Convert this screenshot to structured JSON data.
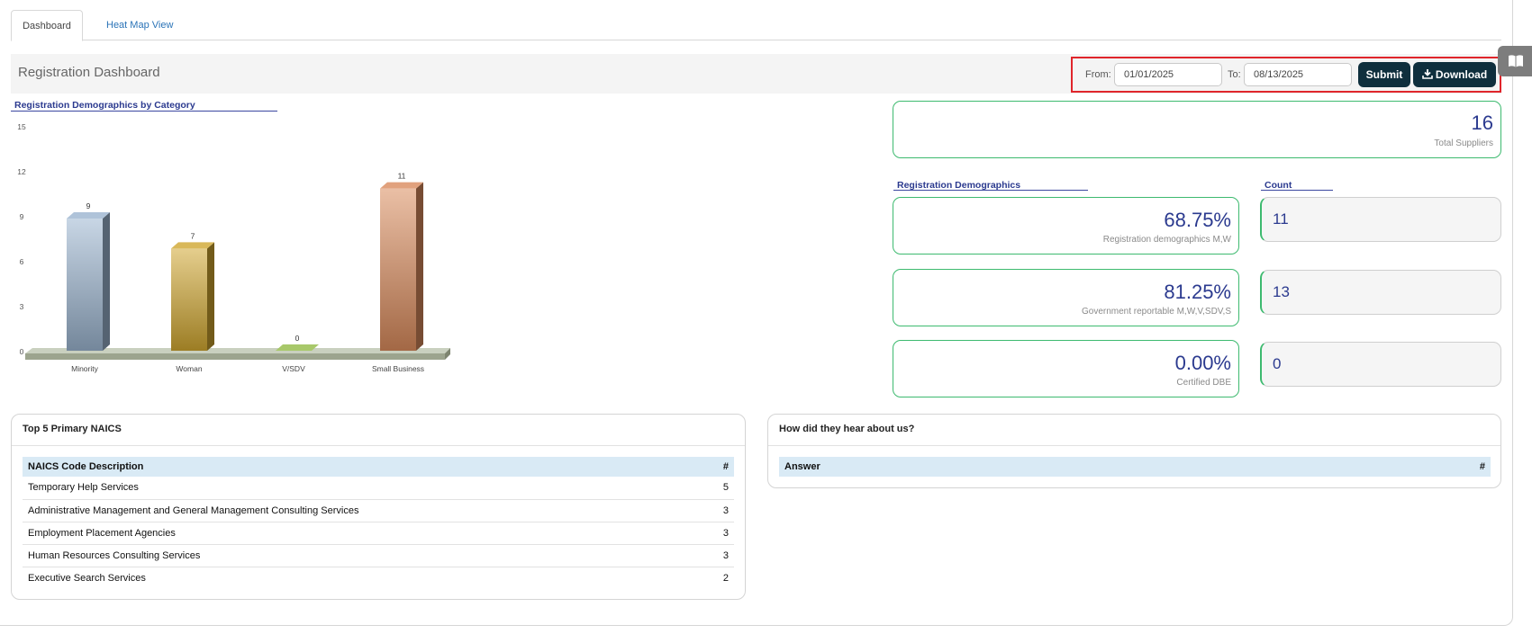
{
  "tabs": [
    {
      "label": "Dashboard",
      "active": true
    },
    {
      "label": "Heat Map View",
      "active": false
    }
  ],
  "header": {
    "title": "Registration Dashboard",
    "from_label": "From:",
    "from_value": "01/01/2025",
    "to_label": "To:",
    "to_value": "08/13/2025",
    "submit_label": "Submit",
    "download_label": "Download"
  },
  "icons": {
    "download": "download-icon",
    "side": "book-icon"
  },
  "colors": {
    "accent_dark": "#0f2f3d",
    "card_border": "#3dba6f",
    "value_text": "#2b3a8f",
    "highlight": "#e0252b",
    "table_header": "#d9eaf5"
  },
  "chart_data": {
    "type": "bar",
    "title": "Registration Demographics by Category",
    "categories": [
      "Minority",
      "Woman",
      "V/SDV",
      "Small Business"
    ],
    "values": [
      9,
      7,
      0,
      11
    ],
    "yticks": [
      0,
      3,
      6,
      9,
      12,
      15
    ],
    "ylim": [
      0,
      15
    ],
    "bar_colors": [
      "#9bb4cf",
      "#d0a630",
      "#a8c86a",
      "#d98a5c"
    ],
    "grid": false,
    "legend": "none",
    "style": "3d"
  },
  "summary": {
    "total_value": "16",
    "total_label": "Total Suppliers"
  },
  "demographics": {
    "heading": "Registration Demographics",
    "count_heading": "Count",
    "items": [
      {
        "value": "68.75%",
        "label": "Registration demographics M,W",
        "count": "11"
      },
      {
        "value": "81.25%",
        "label": "Government reportable M,W,V,SDV,S",
        "count": "13"
      },
      {
        "value": "0.00%",
        "label": "Certified DBE",
        "count": "0"
      }
    ]
  },
  "naics": {
    "title": "Top 5 Primary NAICS",
    "col_desc": "NAICS Code Description",
    "col_num": "#",
    "rows": [
      {
        "desc": "Temporary Help Services",
        "num": "5"
      },
      {
        "desc": "Administrative Management and General Management Consulting Services",
        "num": "3"
      },
      {
        "desc": "Employment Placement Agencies",
        "num": "3"
      },
      {
        "desc": "Human Resources Consulting Services",
        "num": "3"
      },
      {
        "desc": "Executive Search Services",
        "num": "2"
      }
    ]
  },
  "hear": {
    "title": "How did they hear about us?",
    "col_answer": "Answer",
    "col_num": "#"
  }
}
